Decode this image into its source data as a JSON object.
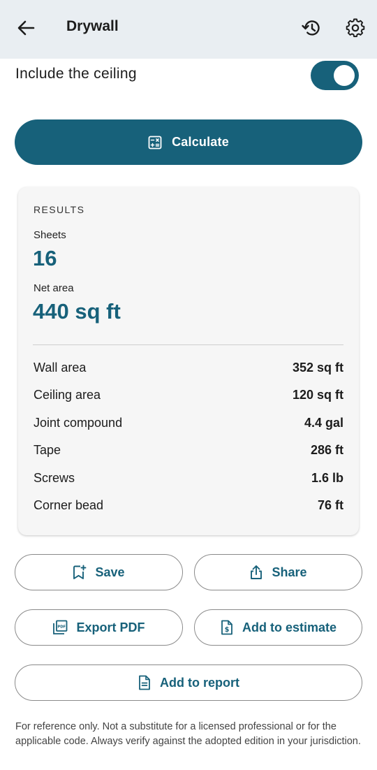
{
  "appbar": {
    "title": "Drywall",
    "back_icon": "arrow-left-icon",
    "history_icon": "history-icon",
    "settings_icon": "gear-icon"
  },
  "options": {
    "include_ceiling_label": "Include the ceiling",
    "include_ceiling_on": true
  },
  "calculate": {
    "label": "Calculate",
    "icon": "calculator-icon"
  },
  "results": {
    "heading": "RESULTS",
    "sheets_label": "Sheets",
    "sheets_value": "16",
    "net_area_label": "Net area",
    "net_area_value": "440 sq ft",
    "rows": [
      {
        "label": "Wall area",
        "value": "352 sq ft"
      },
      {
        "label": "Ceiling area",
        "value": "120 sq ft"
      },
      {
        "label": "Joint compound",
        "value": "4.4 gal"
      },
      {
        "label": "Tape",
        "value": "286 ft"
      },
      {
        "label": "Screws",
        "value": "1.6 lb"
      },
      {
        "label": "Corner bead",
        "value": "76 ft"
      }
    ]
  },
  "actions": {
    "save": "Save",
    "share": "Share",
    "export_pdf": "Export PDF",
    "add_to_estimate": "Add to estimate",
    "add_to_report": "Add to report"
  },
  "disclaimer": "For reference only. Not a substitute for a licensed professional or for the applicable code. Always verify against the adopted edition in your jurisdiction.",
  "colors": {
    "accent": "#17617a",
    "appbar_bg": "#e9eef2",
    "card_bg": "#f6f6f6"
  }
}
